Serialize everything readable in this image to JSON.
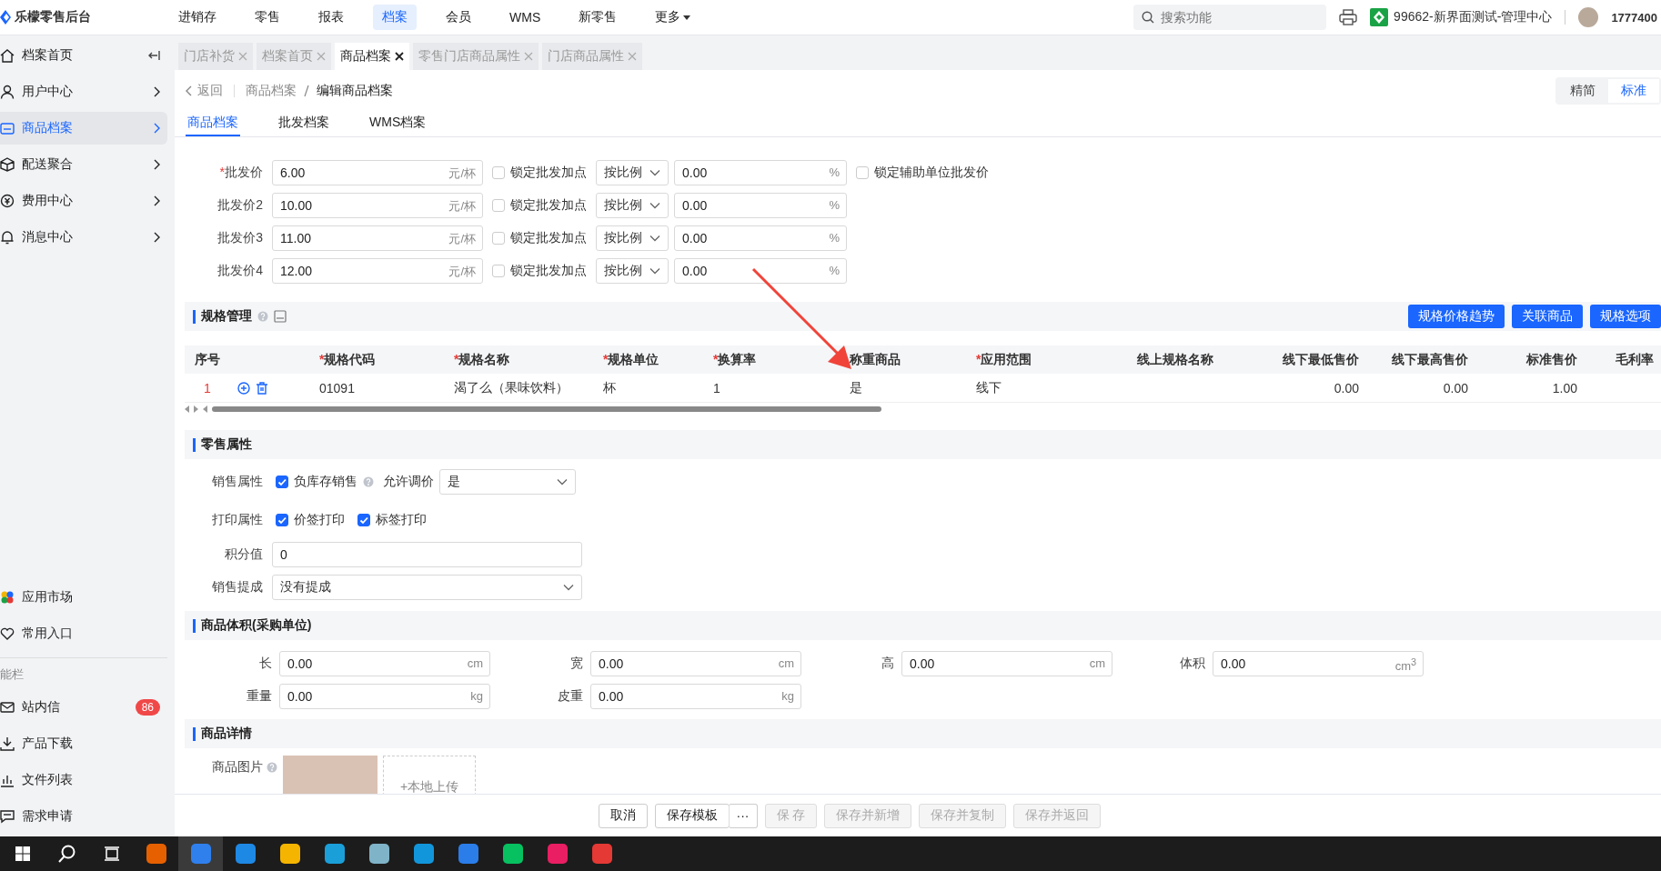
{
  "app": {
    "name": "乐檬零售后台"
  },
  "top_nav": [
    {
      "label": "进销存",
      "selected": false
    },
    {
      "label": "零售",
      "selected": false
    },
    {
      "label": "报表",
      "selected": false
    },
    {
      "label": "档案",
      "selected": true
    },
    {
      "label": "会员",
      "selected": false
    },
    {
      "label": "WMS",
      "selected": false
    },
    {
      "label": "新零售",
      "selected": false
    },
    {
      "label": "更多",
      "selected": false,
      "dropdown": true
    }
  ],
  "header": {
    "search": {
      "placeholder": "搜索功能"
    },
    "store": "99662-新界面测试-管理中心",
    "user": "1777400"
  },
  "sidebar": {
    "items": [
      {
        "label": "档案首页",
        "kind": "collapse",
        "selected": false
      },
      {
        "label": "用户中心",
        "kind": "expand",
        "selected": false
      },
      {
        "label": "商品档案",
        "kind": "expand",
        "selected": true
      },
      {
        "label": "配送聚合",
        "kind": "expand",
        "selected": false
      },
      {
        "label": "费用中心",
        "kind": "expand",
        "selected": false
      },
      {
        "label": "消息中心",
        "kind": "expand",
        "selected": false
      }
    ],
    "shortcuts": [
      {
        "label": "应用市场"
      },
      {
        "label": "常用入口"
      }
    ],
    "section": "能栏",
    "tools": [
      {
        "label": "站内信",
        "badge": "86"
      },
      {
        "label": "产品下载"
      },
      {
        "label": "文件列表"
      },
      {
        "label": "需求申请"
      }
    ]
  },
  "open_tabs": [
    {
      "label": "门店补货",
      "selected": false
    },
    {
      "label": "档案首页",
      "selected": false
    },
    {
      "label": "商品档案",
      "selected": true
    },
    {
      "label": "零售门店商品属性",
      "selected": false
    },
    {
      "label": "门店商品属性",
      "selected": false
    }
  ],
  "breadcrumb": {
    "back": "返回",
    "path": [
      "商品档案"
    ],
    "current": "编辑商品档案"
  },
  "view_modes": [
    {
      "label": "精简",
      "selected": false
    },
    {
      "label": "标准",
      "selected": true
    }
  ],
  "sub_tabs": [
    {
      "label": "商品档案",
      "selected": true
    },
    {
      "label": "批发档案",
      "selected": false
    },
    {
      "label": "WMS档案",
      "selected": false
    }
  ],
  "wholesale_prices": [
    {
      "mark": "*",
      "label": "批发价",
      "value": "6.00",
      "unit": "元/杯",
      "lock_label": "锁定批发加点",
      "locked": false,
      "mode": "按比例",
      "percent": "0.00",
      "percent_unit": "%",
      "aux_label": "锁定辅助单位批发价",
      "aux_locked": false
    },
    {
      "label": "批发价2",
      "value": "10.00",
      "unit": "元/杯",
      "lock_label": "锁定批发加点",
      "locked": false,
      "mode": "按比例",
      "percent": "0.00",
      "percent_unit": "%"
    },
    {
      "label": "批发价3",
      "value": "11.00",
      "unit": "元/杯",
      "lock_label": "锁定批发加点",
      "locked": false,
      "mode": "按比例",
      "percent": "0.00",
      "percent_unit": "%"
    },
    {
      "label": "批发价4",
      "value": "12.00",
      "unit": "元/杯",
      "lock_label": "锁定批发加点",
      "locked": false,
      "mode": "按比例",
      "percent": "0.00",
      "percent_unit": "%"
    }
  ],
  "spec_section": {
    "title": "规格管理",
    "buttons": [
      "规格价格趋势",
      "关联商品",
      "规格选项"
    ],
    "table": {
      "columns": [
        {
          "label": "序号",
          "kind": "index"
        },
        {
          "kind": "actions"
        },
        {
          "mark": "*",
          "label": "规格代码",
          "kind": "text"
        },
        {
          "mark": "*",
          "label": "规格名称",
          "kind": "text"
        },
        {
          "mark": "*",
          "label": "规格单位",
          "kind": "text"
        },
        {
          "mark": "*",
          "label": "换算率",
          "kind": "text"
        },
        {
          "label": "称重商品",
          "kind": "text"
        },
        {
          "mark": "*",
          "label": "应用范围",
          "kind": "text"
        },
        {
          "label": "线上规格名称",
          "kind": "text"
        },
        {
          "label": "线下最低售价",
          "kind": "number"
        },
        {
          "label": "线下最高售价",
          "kind": "number"
        },
        {
          "label": "标准售价",
          "kind": "number"
        },
        {
          "label": "毛利率",
          "kind": "number"
        }
      ],
      "rows": [
        {
          "cells": [
            "1",
            "",
            "01091",
            "渴了么（果味饮料）",
            "杯",
            "1",
            "是",
            "线下",
            "",
            "0.00",
            "0.00",
            "1.00",
            ""
          ]
        }
      ]
    }
  },
  "retail_section": {
    "title": "零售属性",
    "sale_label": "销售属性",
    "negative_stock": {
      "label": "负库存销售",
      "checked": true
    },
    "price_adjust": {
      "label": "允许调价",
      "value": "是"
    },
    "print_label": "打印属性",
    "print_options": [
      {
        "label": "价签打印",
        "checked": true
      },
      {
        "label": "标签打印",
        "checked": true
      }
    ],
    "points": {
      "label": "积分值",
      "value": "0"
    },
    "commission": {
      "label": "销售提成",
      "value": "没有提成"
    }
  },
  "volume_section": {
    "title": "商品体积(采购单位)",
    "fields": [
      {
        "label": "长",
        "value": "0.00",
        "unit": "cm"
      },
      {
        "label": "宽",
        "value": "0.00",
        "unit": "cm"
      },
      {
        "label": "高",
        "value": "0.00",
        "unit": "cm"
      },
      {
        "label": "体积",
        "value": "0.00",
        "unit": "cm$^{3}$"
      },
      {
        "label": "重量",
        "value": "0.00",
        "unit": "kg"
      },
      {
        "label": "皮重",
        "value": "0.00",
        "unit": "kg"
      }
    ]
  },
  "detail_section": {
    "title": "商品详情",
    "image_label": "商品图片",
    "upload": "+本地上传"
  },
  "actions": [
    {
      "kind": "button",
      "label": "取消",
      "disabled": false
    },
    {
      "kind": "button",
      "label": "保存模板",
      "disabled": false
    },
    {
      "kind": "more",
      "label": "···",
      "disabled": false
    },
    {
      "kind": "button",
      "label": "保 存",
      "disabled": true
    },
    {
      "kind": "button",
      "label": "保存并新增",
      "disabled": true
    },
    {
      "kind": "button",
      "label": "保存并复制",
      "disabled": true
    },
    {
      "kind": "button",
      "label": "保存并返回",
      "disabled": true
    }
  ],
  "taskbar": {
    "apps": [
      {
        "color": "#e66000",
        "selected": false
      },
      {
        "color": "#2f80ed",
        "selected": true
      },
      {
        "color": "#1e88e5",
        "selected": false
      },
      {
        "color": "#f4b400",
        "selected": false
      },
      {
        "color": "#1a9fd9",
        "selected": false
      },
      {
        "color": "#7fb3c8",
        "selected": false
      },
      {
        "color": "#1296db",
        "selected": false
      },
      {
        "color": "#2b7de9",
        "selected": false
      },
      {
        "color": "#07c160",
        "selected": false
      },
      {
        "color": "#e91e63",
        "selected": false
      },
      {
        "color": "#e53935",
        "selected": false
      }
    ]
  }
}
